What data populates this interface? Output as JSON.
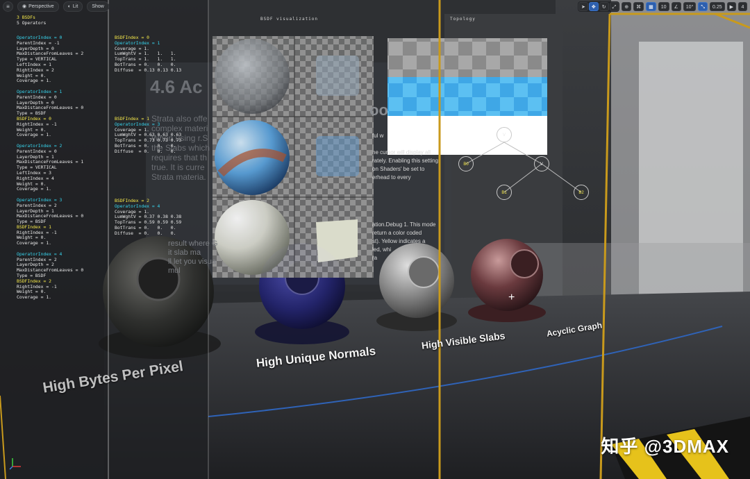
{
  "toolbar": {
    "menu_icon": "hamburger-icon",
    "perspective_label": "Perspective",
    "lit_label": "Lit",
    "show_label": "Show",
    "grid_snap_value": "10",
    "rotation_snap_value": "10°",
    "scale_snap_value": "0.25",
    "camera_speed_value": "4"
  },
  "panels": {
    "bsdf_title": "BSDF visualization",
    "topology_title": "Topology"
  },
  "debug": {
    "summary": [
      "3 BSDFs",
      "5 Operators"
    ],
    "col1": [
      {
        "t": "OperatorIndex = 0",
        "c": "cyan"
      },
      {
        "t": "ParentIndex = -1",
        "c": "w"
      },
      {
        "t": "LayerDepth = 0",
        "c": "w"
      },
      {
        "t": "MaxDistanceFromLeaves = 2",
        "c": "w"
      },
      {
        "t": "Type = VERTICAL",
        "c": "w"
      },
      {
        "t": "LeftIndex = 1",
        "c": "w"
      },
      {
        "t": "RightIndex = 2",
        "c": "w"
      },
      {
        "t": "Weight = 0.",
        "c": "w"
      },
      {
        "t": "Coverage = 1.",
        "c": "w"
      },
      {
        "t": "",
        "c": "w"
      },
      {
        "t": "OperatorIndex = 1",
        "c": "cyan"
      },
      {
        "t": "ParentIndex = 0",
        "c": "w"
      },
      {
        "t": "LayerDepth = 0",
        "c": "w"
      },
      {
        "t": "MaxDistanceFromLeaves = 0",
        "c": "w"
      },
      {
        "t": "Type = BSDF",
        "c": "w"
      },
      {
        "t": "BSDFIndex = 0",
        "c": "yellow"
      },
      {
        "t": "RightIndex = -1",
        "c": "w"
      },
      {
        "t": "Weight = 0.",
        "c": "w"
      },
      {
        "t": "Coverage = 1.",
        "c": "w"
      },
      {
        "t": "",
        "c": "w"
      },
      {
        "t": "OperatorIndex = 2",
        "c": "cyan"
      },
      {
        "t": "ParentIndex = 0",
        "c": "w"
      },
      {
        "t": "LayerDepth = 1",
        "c": "w"
      },
      {
        "t": "MaxDistanceFromLeaves = 1",
        "c": "w"
      },
      {
        "t": "Type = VERTICAL",
        "c": "w"
      },
      {
        "t": "LeftIndex = 3",
        "c": "w"
      },
      {
        "t": "RightIndex = 4",
        "c": "w"
      },
      {
        "t": "Weight = 0.",
        "c": "w"
      },
      {
        "t": "Coverage = 1.",
        "c": "w"
      },
      {
        "t": "",
        "c": "w"
      },
      {
        "t": "OperatorIndex = 3",
        "c": "cyan"
      },
      {
        "t": "ParentIndex = 2",
        "c": "w"
      },
      {
        "t": "LayerDepth = 1",
        "c": "w"
      },
      {
        "t": "MaxDistanceFromLeaves = 0",
        "c": "w"
      },
      {
        "t": "Type = BSDF",
        "c": "w"
      },
      {
        "t": "BSDFIndex = 1",
        "c": "yellow"
      },
      {
        "t": "RightIndex = -1",
        "c": "w"
      },
      {
        "t": "Weight = 0.",
        "c": "w"
      },
      {
        "t": "Coverage = 1.",
        "c": "w"
      },
      {
        "t": "",
        "c": "w"
      },
      {
        "t": "OperatorIndex = 4",
        "c": "cyan"
      },
      {
        "t": "ParentIndex = 2",
        "c": "w"
      },
      {
        "t": "LayerDepth = 2",
        "c": "w"
      },
      {
        "t": "MaxDistanceFromLeaves = 0",
        "c": "w"
      },
      {
        "t": "Type = BSDF",
        "c": "w"
      },
      {
        "t": "BSDFIndex = 2",
        "c": "yellow"
      },
      {
        "t": "RightIndex = -1",
        "c": "w"
      },
      {
        "t": "Weight = 0.",
        "c": "w"
      },
      {
        "t": "Coverage = 1.",
        "c": "w"
      }
    ],
    "col2_blocks": [
      [
        {
          "t": "BSDFIndex = 0",
          "c": "yellow"
        },
        {
          "t": "OperatorIndex = 1",
          "c": "cyan"
        },
        {
          "t": "Coverage = 1.",
          "c": "w"
        },
        {
          "t": "LumWghtV = 1.   1.   1.",
          "c": "w"
        },
        {
          "t": "TopTrans = 1.   1.   1.",
          "c": "w"
        },
        {
          "t": "BotTrans = 0.   0.   0.",
          "c": "w"
        },
        {
          "t": "Diffuse  = 0.13 0.13 0.13",
          "c": "w"
        }
      ],
      [
        {
          "t": "BSDFIndex = 1",
          "c": "yellow"
        },
        {
          "t": "OperatorIndex = 3",
          "c": "cyan"
        },
        {
          "t": "Coverage = 1.",
          "c": "w"
        },
        {
          "t": "LumWghtV = 0.63 0.63 0.63",
          "c": "w"
        },
        {
          "t": "TopTrans = 0.73 0.73 0.73",
          "c": "w"
        },
        {
          "t": "BotTrans = 0.   0.   0.",
          "c": "w"
        },
        {
          "t": "Diffuse  = 0.   0.   0.",
          "c": "w"
        }
      ],
      [
        {
          "t": "BSDFIndex = 2",
          "c": "yellow"
        },
        {
          "t": "OperatorIndex = 4",
          "c": "cyan"
        },
        {
          "t": "Coverage = 1.",
          "c": "w"
        },
        {
          "t": "LumWghtV = 0.37 0.38 0.38",
          "c": "w"
        },
        {
          "t": "TopTrans = 0.59 0.59 0.59",
          "c": "w"
        },
        {
          "t": "BotTrans = 0.   0.   0.",
          "c": "w"
        },
        {
          "t": "Diffuse  = 0.   0.   0.",
          "c": "w"
        }
      ]
    ]
  },
  "background_text": {
    "heading": "4.6 Ac",
    "heading_right": "oo",
    "para_left": [
      "Strata also offe",
      "complex materi",
      "When using r.S",
      "the Slabs which",
      "requires that th",
      "true. It is curre",
      "Strata materia."
    ],
    "para_right": [
      "ful w",
      "",
      "he cursor will display all",
      "rately. Enabling this setting",
      "on Shaders' be set to",
      "erhead to every"
    ],
    "para2_left": [
      "result where G",
      "it slab ma",
      "ll let you visua",
      "mul"
    ],
    "para2_right": [
      "ation.Debug 1. This mode",
      "return a color coded",
      "st). Yellow indicates a",
      "led, whi",
      "ra"
    ]
  },
  "topology": {
    "nodes": [
      {
        "label": "V",
        "kind": "white"
      },
      {
        "label": "B0",
        "kind": "yellow"
      },
      {
        "label": "V",
        "kind": "white"
      },
      {
        "label": "B1",
        "kind": "yellow"
      },
      {
        "label": "B2",
        "kind": "yellow"
      }
    ]
  },
  "floor_labels": [
    "High Bytes Per Pixel",
    "High Unique Normals",
    "High Visible Slabs",
    "Acyclic Graph"
  ],
  "watermark": "知乎 @3DMAX",
  "colors": {
    "cyan": "#37d6ef",
    "yellow": "#f6e94a",
    "topology_blue": "#56b8f0",
    "frame_gold": "#c99a1c"
  }
}
